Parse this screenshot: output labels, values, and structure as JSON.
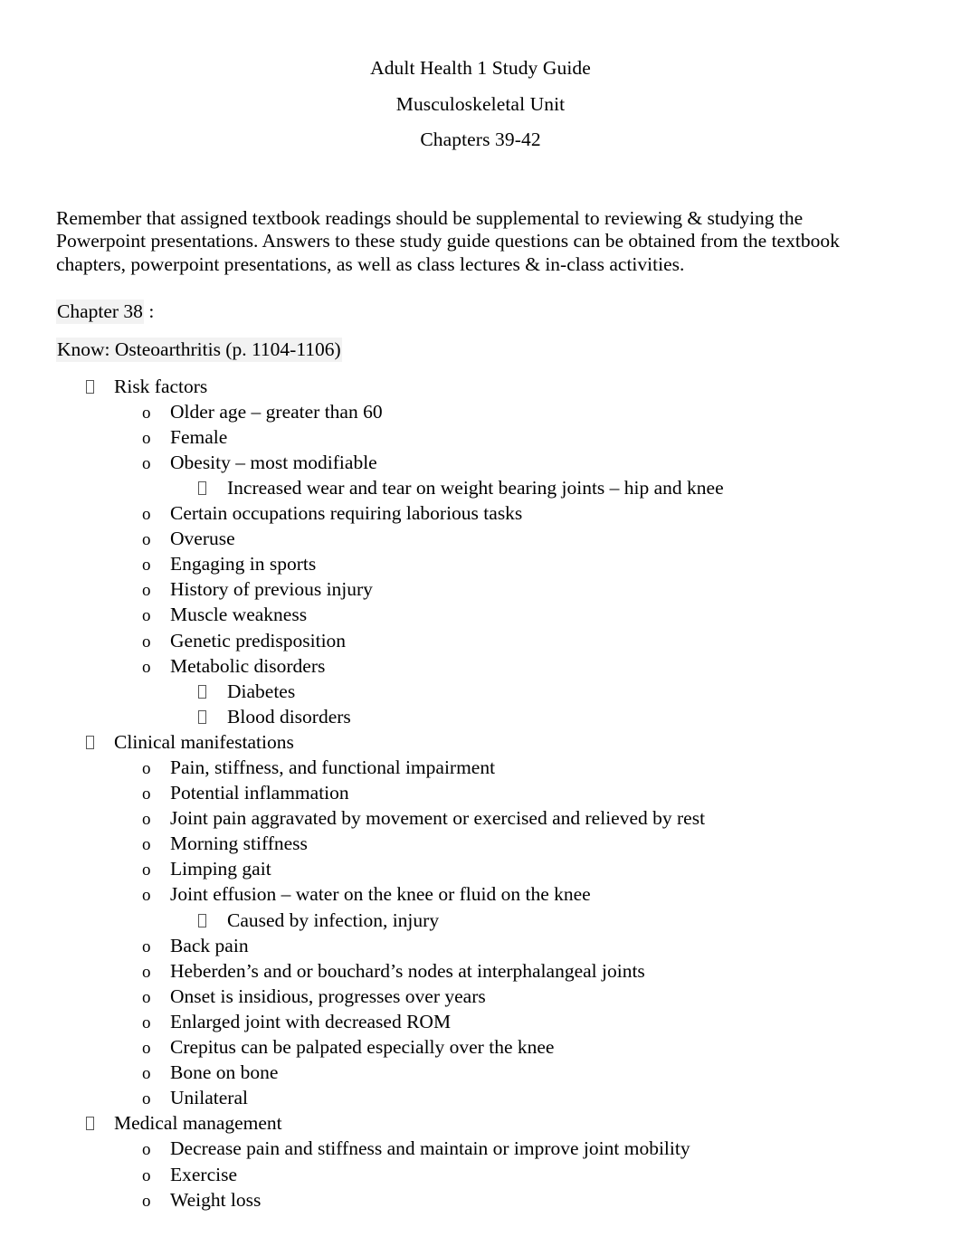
{
  "document": {
    "title_lines": [
      "Adult Health 1 Study Guide",
      "Musculoskeletal Unit",
      "Chapters 39-42"
    ],
    "intro": "Remember that assigned textbook readings should be supplemental to reviewing & studying the Powerpoint presentations. Answers to these study guide questions can be obtained from the textbook chapters, powerpoint presentations, as well as class lectures & in-class activities.",
    "chapter_heading": "Chapter 38",
    "chapter_heading_suffix": " :",
    "topic_heading": "Know: Osteoarthritis (p. 1104-1106)",
    "highlight_color": "#f2f2f2",
    "markers": {
      "level1": "tofu-box",
      "level2": "o",
      "level3": "tofu-box"
    },
    "outline": [
      {
        "level": 1,
        "text": "Risk factors"
      },
      {
        "level": 2,
        "text": "Older age – greater than 60"
      },
      {
        "level": 2,
        "text": "Female"
      },
      {
        "level": 2,
        "text": "Obesity – most modifiable"
      },
      {
        "level": 3,
        "text": "Increased wear and tear on weight bearing joints – hip and knee"
      },
      {
        "level": 2,
        "text": "Certain occupations requiring laborious tasks"
      },
      {
        "level": 2,
        "text": "Overuse"
      },
      {
        "level": 2,
        "text": "Engaging in sports"
      },
      {
        "level": 2,
        "text": "History of previous injury"
      },
      {
        "level": 2,
        "text": "Muscle weakness"
      },
      {
        "level": 2,
        "text": "Genetic predisposition"
      },
      {
        "level": 2,
        "text": "Metabolic disorders"
      },
      {
        "level": 3,
        "text": "Diabetes"
      },
      {
        "level": 3,
        "text": "Blood disorders"
      },
      {
        "level": 1,
        "text": "Clinical manifestations"
      },
      {
        "level": 2,
        "text": "Pain, stiffness, and functional impairment"
      },
      {
        "level": 2,
        "text": "Potential inflammation"
      },
      {
        "level": 2,
        "text": "Joint pain aggravated by movement or exercised and relieved by rest"
      },
      {
        "level": 2,
        "text": "Morning stiffness"
      },
      {
        "level": 2,
        "text": "Limping gait"
      },
      {
        "level": 2,
        "text": "Joint effusion – water on the knee or fluid on the knee"
      },
      {
        "level": 3,
        "text": "Caused by infection, injury"
      },
      {
        "level": 2,
        "text": "Back pain"
      },
      {
        "level": 2,
        "text": "Heberden’s and or bouchard’s nodes at interphalangeal joints"
      },
      {
        "level": 2,
        "text": "Onset is insidious, progresses over years"
      },
      {
        "level": 2,
        "text": "Enlarged joint with decreased ROM"
      },
      {
        "level": 2,
        "text": "Crepitus can be palpated especially over the knee"
      },
      {
        "level": 2,
        "text": "Bone on bone"
      },
      {
        "level": 2,
        "text": "Unilateral"
      },
      {
        "level": 1,
        "text": "Medical management"
      },
      {
        "level": 2,
        "text": "Decrease pain and stiffness and maintain or improve joint mobility"
      },
      {
        "level": 2,
        "text": "Exercise"
      },
      {
        "level": 2,
        "text": "Weight loss"
      }
    ]
  }
}
